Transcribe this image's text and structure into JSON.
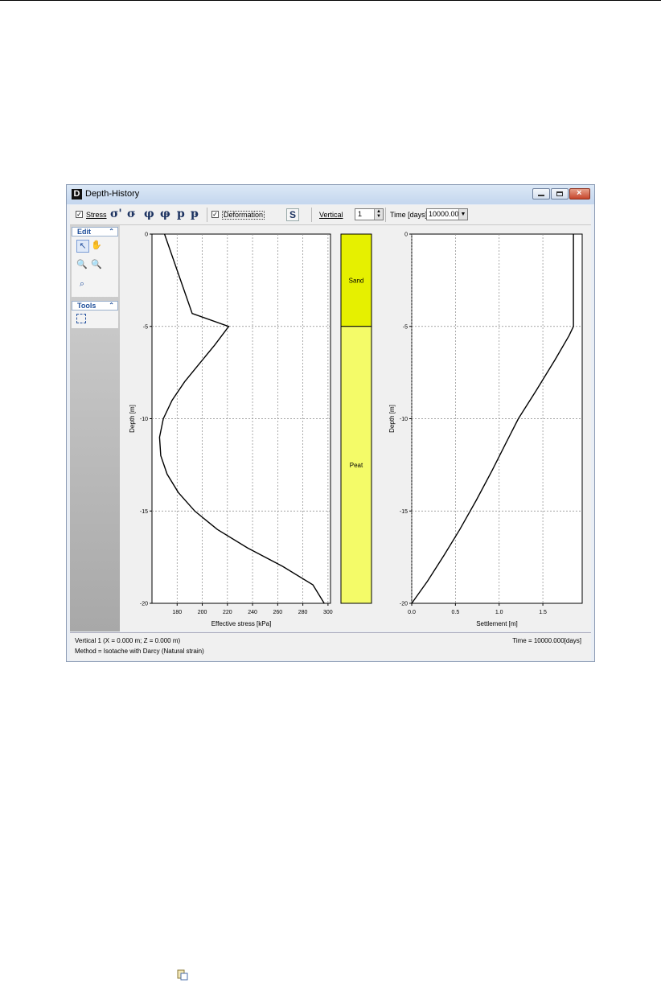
{
  "window": {
    "title": "Depth-History",
    "app_letter": "D"
  },
  "toolbar": {
    "stress_label": "Stress",
    "stress_checked": true,
    "symbols": [
      "σ'",
      "σ̵",
      "φ",
      "φ̵",
      "p",
      "p̵"
    ],
    "deformation_label": "Deformation",
    "deformation_checked": true,
    "settlement_symbol": "S",
    "vertical_label": "Vertical",
    "vertical_value": "1",
    "time_label": "Time [days]",
    "time_value": "10000.000"
  },
  "sidebar": {
    "edit_title": "Edit",
    "tools_title": "Tools"
  },
  "status": {
    "location": "Vertical 1 (X = 0.000 m; Z = 0.000 m)",
    "method": "Method = Isotache with Darcy (Natural strain)",
    "time": "Time = 10000.000[days]"
  },
  "chart_data": [
    {
      "type": "line",
      "xlabel": "Effective stress [kPa]",
      "ylabel": "Depth [m]",
      "xlim": [
        160,
        302
      ],
      "ylim": [
        -20,
        0
      ],
      "xticks": [
        180,
        200,
        220,
        240,
        260,
        280,
        300
      ],
      "yticks": [
        0,
        -5,
        -10,
        -15,
        -20
      ],
      "grid": true,
      "series": [
        {
          "x": [
            170,
            192,
            221,
            210,
            198,
            186,
            176,
            169,
            166,
            167,
            172,
            181,
            194,
            212,
            236,
            264,
            288,
            297
          ],
          "y": [
            0,
            -4.3,
            -5,
            -6,
            -7,
            -8,
            -9,
            -10,
            -11,
            -12,
            -13,
            -14,
            -15,
            -16,
            -17,
            -18,
            -19,
            -20
          ]
        }
      ]
    },
    {
      "type": "bar",
      "layers": [
        {
          "name": "Sand",
          "top": 0,
          "bottom": -5,
          "color": "#e6f000"
        },
        {
          "name": "Peat",
          "top": -5,
          "bottom": -20,
          "color": "#f4fb68"
        }
      ]
    },
    {
      "type": "line",
      "xlabel": "Settlement [m]",
      "ylabel": "Depth [m]",
      "xlim": [
        0,
        1.95
      ],
      "ylim": [
        -20,
        0
      ],
      "xticks": [
        "0.0",
        "0.5",
        "1.0",
        "1.5"
      ],
      "yticks": [
        0,
        -5,
        -10,
        -15,
        -20
      ],
      "grid": true,
      "series": [
        {
          "x": [
            1.85,
            1.85,
            1.8,
            1.64,
            1.42,
            1.22,
            1.08,
            0.92,
            0.74,
            0.55,
            0.37,
            0.18,
            0.0
          ],
          "y": [
            0,
            -5,
            -5.5,
            -6.8,
            -8.5,
            -10,
            -11.3,
            -12.8,
            -14.4,
            -16,
            -17.4,
            -18.8,
            -20
          ]
        }
      ]
    }
  ]
}
